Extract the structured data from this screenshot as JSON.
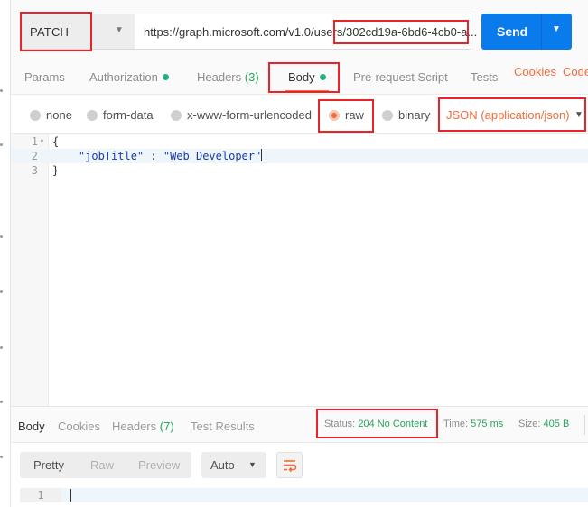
{
  "request": {
    "method": "PATCH",
    "url": "https://graph.microsoft.com/v1.0/users/",
    "url_highlight": "302cd19a-6bd6-4cb0-a...",
    "send_label": "Send"
  },
  "tabs": {
    "params": "Params",
    "authorization": "Authorization",
    "headers": "Headers",
    "headers_count": "(3)",
    "body": "Body",
    "prerequest": "Pre-request Script",
    "tests": "Tests",
    "cookies": "Cookies",
    "code": "Code"
  },
  "body_types": {
    "none": "none",
    "form_data": "form-data",
    "urlencoded": "x-www-form-urlencoded",
    "raw": "raw",
    "binary": "binary",
    "selected": "raw",
    "content_type": "JSON (application/json)"
  },
  "editor": {
    "lines": [
      {
        "no": "1",
        "text": "{"
      },
      {
        "no": "2",
        "key": "\"jobTitle\"",
        "sep": " : ",
        "value": "\"Web Developer\""
      },
      {
        "no": "3",
        "text": "}"
      }
    ]
  },
  "response": {
    "tabs": {
      "body": "Body",
      "cookies": "Cookies",
      "headers": "Headers",
      "headers_count": "(7)",
      "test_results": "Test Results"
    },
    "status_label": "Status:",
    "status_value": "204 No Content",
    "time_label": "Time:",
    "time_value": "575 ms",
    "size_label": "Size:",
    "size_value": "405 B",
    "view_modes": [
      "Pretty",
      "Raw",
      "Preview"
    ],
    "format": "Auto",
    "line_no": "1"
  },
  "colors": {
    "accent": "#f26b3a",
    "send": "#097bed",
    "success": "#26a65b",
    "annotation": "#e8232a"
  }
}
